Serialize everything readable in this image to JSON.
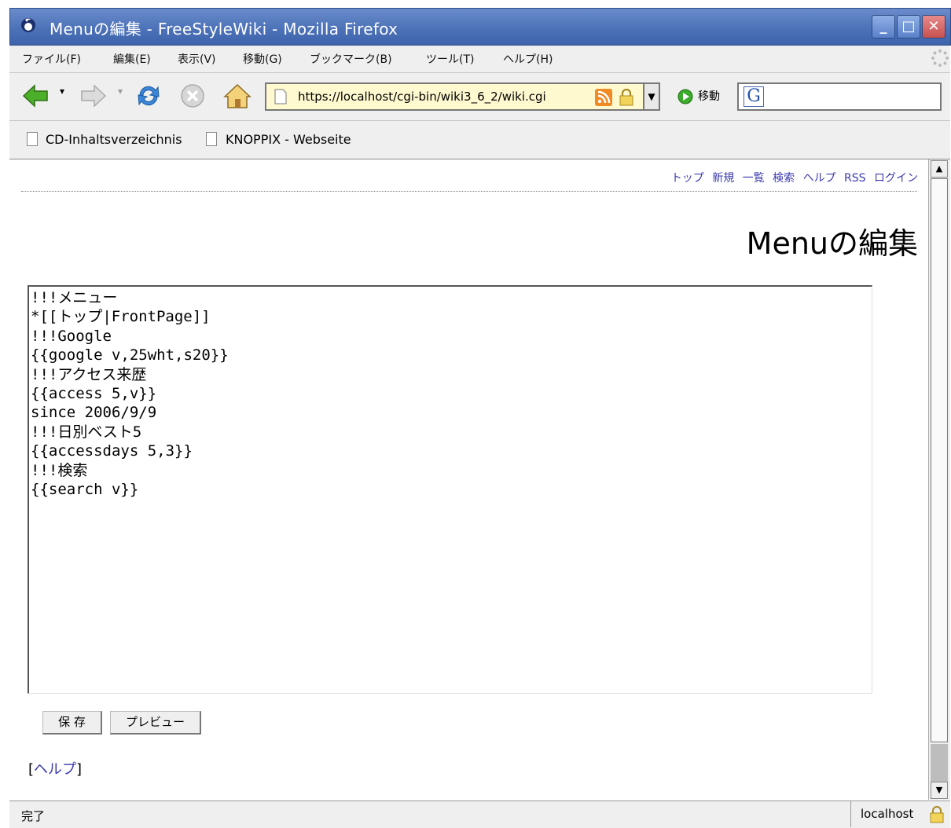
{
  "window": {
    "title": "Menuの編集 - FreeStyleWiki - Mozilla Firefox",
    "min_label": "_",
    "max_label": "□",
    "close_label": "✕"
  },
  "menubar": {
    "items": [
      "ファイル(F)",
      "編集(E)",
      "表示(V)",
      "移動(G)",
      "ブックマーク(B)",
      "ツール(T)",
      "ヘルプ(H)"
    ]
  },
  "navbar": {
    "url": "https://localhost/cgi-bin/wiki3_6_2/wiki.cgi",
    "go_label": "移動",
    "search_placeholder": ""
  },
  "bookmarks": {
    "items": [
      "CD-Inhaltsverzeichnis",
      "KNOPPIX - Webseite"
    ]
  },
  "page": {
    "topnav": [
      "トップ",
      "新規",
      "一覧",
      "検索",
      "ヘルプ",
      "RSS",
      "ログイン"
    ],
    "title": "Menuの編集",
    "editor_content": "!!!メニュー\n*[[トップ|FrontPage]]\n!!!Google\n{{google v,25wht,s20}}\n!!!アクセス来歴\n{{access 5,v}}\nsince 2006/9/9\n!!!日別ベスト5\n{{accessdays 5,3}}\n!!!検索\n{{search v}}",
    "save_label": "保 存",
    "preview_label": "プレビュー",
    "help_bracket_open": "[",
    "help_label": "ヘルプ",
    "help_bracket_close": "]"
  },
  "status": {
    "text": "完了",
    "host": "localhost"
  },
  "colors": {
    "titlebar": "#4d72b8",
    "link": "#3a3ab0",
    "urlbar_bg": "#fff9d0"
  }
}
